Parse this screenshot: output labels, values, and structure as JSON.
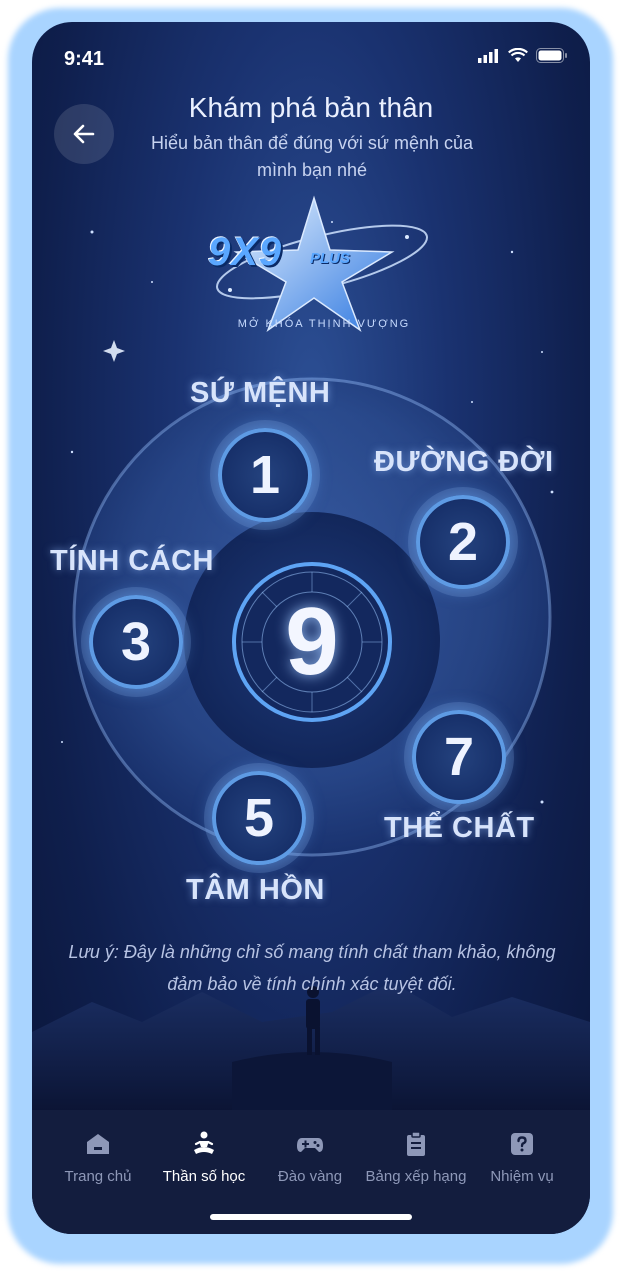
{
  "status": {
    "time": "9:41"
  },
  "header": {
    "title": "Khám phá bản thân",
    "subtitle": "Hiểu bản thân để đúng với sứ mệnh của mình bạn nhé"
  },
  "logo": {
    "brand": "9X9",
    "brand_suffix": "PLUS",
    "tagline": "MỞ KHÓA THỊNH VƯỢNG"
  },
  "indices": {
    "center": {
      "value": "9"
    },
    "su_menh": {
      "label": "SỨ MỆNH",
      "value": "1"
    },
    "duong_doi": {
      "label": "ĐƯỜNG ĐỜI",
      "value": "2"
    },
    "tinh_cach": {
      "label": "TÍNH CÁCH",
      "value": "3"
    },
    "tam_hon": {
      "label": "TÂM HỒN",
      "value": "5"
    },
    "the_chat": {
      "label": "THỂ CHẤT",
      "value": "7"
    }
  },
  "note": "Lưu ý: Đây là những chỉ số mang tính chất tham khảo, không đảm bảo về tính chính xác tuyệt đối.",
  "nav": {
    "items": [
      {
        "label": "Trang chủ",
        "icon": "home-icon"
      },
      {
        "label": "Thần số học",
        "icon": "meditation-icon",
        "active": true
      },
      {
        "label": "Đào vàng",
        "icon": "gamepad-icon"
      },
      {
        "label": "Bảng xếp hạng",
        "icon": "clipboard-icon"
      },
      {
        "label": "Nhiệm vụ",
        "icon": "question-icon"
      }
    ]
  },
  "colors": {
    "accent": "#5e9be4",
    "background": "#1a3270",
    "nav_bg": "#131d3e"
  }
}
